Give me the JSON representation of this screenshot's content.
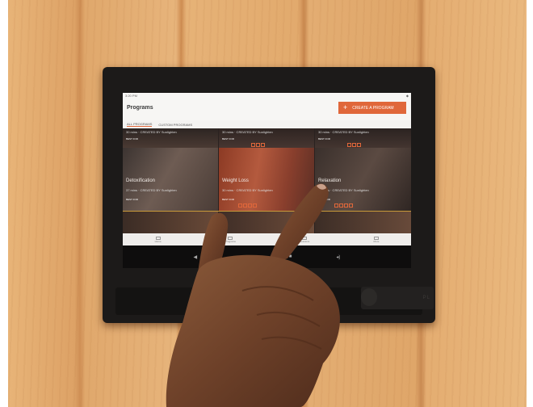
{
  "screen": {
    "status_time": "3:20 PM",
    "title": "Programs",
    "create_button": "CREATE A PROGRAM",
    "tabs": [
      "ALL PROGRAMS",
      "CUSTOM PROGRAMS"
    ],
    "tiles_top": [
      {
        "meta": "30 mins · CREATED BY Sunlighten",
        "best": "BEST FOR"
      },
      {
        "meta": "30 mins · CREATED BY Sunlighten",
        "best": "BEST FOR"
      },
      {
        "meta": "30 mins · CREATED BY Sunlighten",
        "best": "BEST FOR"
      }
    ],
    "tiles": [
      {
        "name": "Detoxification",
        "meta": "37 mins · CREATED BY Sunlighten",
        "best": "BEST FOR"
      },
      {
        "name": "Weight Loss",
        "meta": "30 mins · CREATED BY Sunlighten",
        "best": "BEST FOR"
      },
      {
        "name": "Relaxation",
        "meta": "30 mins · CREATED BY Sunlighten",
        "best": "BEST FOR"
      }
    ],
    "nav": [
      "Home",
      "Programs",
      "Sessions",
      "More"
    ]
  },
  "colors": {
    "accent": "#e0673a",
    "wood": "#dfa669",
    "tablet": "#1c1a19"
  },
  "icons": [
    "plus-icon",
    "home-icon",
    "programs-icon",
    "sessions-icon",
    "more-icon",
    "back-icon",
    "home-circle-icon",
    "recents-icon",
    "volume-icon"
  ]
}
